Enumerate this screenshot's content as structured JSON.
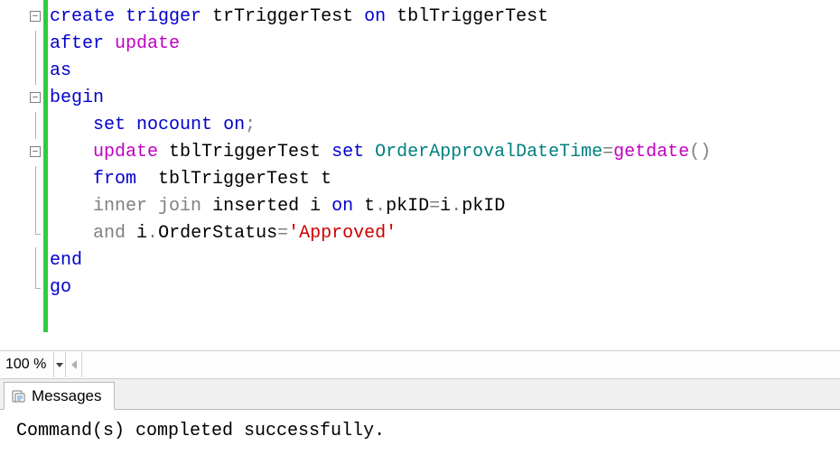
{
  "code": {
    "lines": [
      {
        "fold": "minus",
        "tokens": [
          [
            "kw-blue",
            "create"
          ],
          [
            "txt",
            " "
          ],
          [
            "kw-blue",
            "trigger"
          ],
          [
            "txt",
            " trTriggerTest "
          ],
          [
            "kw-blue",
            "on"
          ],
          [
            "txt",
            " tblTriggerTest"
          ]
        ]
      },
      {
        "foldline": true,
        "tokens": [
          [
            "kw-blue",
            "after"
          ],
          [
            "txt",
            " "
          ],
          [
            "kw-magenta",
            "update"
          ]
        ]
      },
      {
        "foldline": true,
        "tokens": [
          [
            "kw-blue",
            "as"
          ]
        ]
      },
      {
        "fold": "minus",
        "tokens": [
          [
            "kw-blue",
            "begin"
          ]
        ]
      },
      {
        "foldline": true,
        "indent": 1,
        "tokens": [
          [
            "kw-blue",
            "set"
          ],
          [
            "txt",
            " "
          ],
          [
            "kw-blue",
            "nocount"
          ],
          [
            "txt",
            " "
          ],
          [
            "kw-blue",
            "on"
          ],
          [
            "kw-gray",
            ";"
          ]
        ]
      },
      {
        "fold": "minus",
        "indent": 1,
        "tokens": [
          [
            "kw-magenta",
            "update"
          ],
          [
            "txt",
            " tblTriggerTest "
          ],
          [
            "kw-blue",
            "set"
          ],
          [
            "txt",
            " "
          ],
          [
            "kw-teal",
            "OrderApprovalDateTime"
          ],
          [
            "kw-gray",
            "="
          ],
          [
            "kw-magenta",
            "getdate"
          ],
          [
            "kw-gray",
            "()"
          ]
        ]
      },
      {
        "foldline": true,
        "indent": 1,
        "tokens": [
          [
            "kw-blue",
            "from"
          ],
          [
            "txt",
            "  tblTriggerTest t"
          ]
        ]
      },
      {
        "foldline": true,
        "indent": 1,
        "tokens": [
          [
            "kw-gray",
            "inner"
          ],
          [
            "txt",
            " "
          ],
          [
            "kw-gray",
            "join"
          ],
          [
            "txt",
            " inserted i "
          ],
          [
            "kw-blue",
            "on"
          ],
          [
            "txt",
            " t"
          ],
          [
            "kw-gray",
            "."
          ],
          [
            "txt",
            "pkID"
          ],
          [
            "kw-gray",
            "="
          ],
          [
            "txt",
            "i"
          ],
          [
            "kw-gray",
            "."
          ],
          [
            "txt",
            "pkID"
          ]
        ]
      },
      {
        "foldlineend": true,
        "indent": 1,
        "tokens": [
          [
            "kw-gray",
            "and"
          ],
          [
            "txt",
            " i"
          ],
          [
            "kw-gray",
            "."
          ],
          [
            "txt",
            "OrderStatus"
          ],
          [
            "kw-gray",
            "="
          ],
          [
            "str-red",
            "'Approved'"
          ]
        ]
      },
      {
        "foldline": true,
        "tokens": [
          [
            "kw-blue",
            "end"
          ]
        ]
      },
      {
        "foldlineend": true,
        "tokens": [
          [
            "kw-blue",
            "go"
          ]
        ]
      }
    ]
  },
  "zoom": {
    "value": "100 %"
  },
  "tabs": {
    "messages": "Messages"
  },
  "messages": {
    "text": "Command(s) completed successfully."
  }
}
